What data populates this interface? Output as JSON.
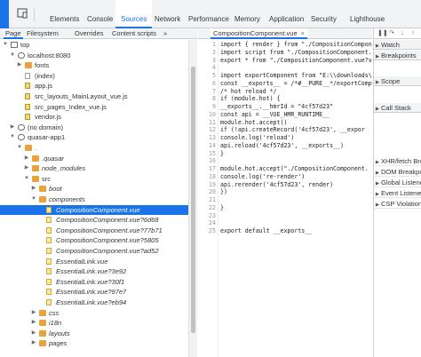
{
  "tabs": [
    "Elements",
    "Console",
    "Sources",
    "Network",
    "Performance",
    "Memory",
    "Application",
    "Security",
    "Lighthouse"
  ],
  "active_tab": "Sources",
  "navigator_tabs": [
    "Page",
    "Filesystem",
    "Overrides",
    "Content scripts"
  ],
  "navigator_more": "»",
  "tree": [
    {
      "label": "top",
      "arrow": "▼",
      "icon": "frame"
    },
    {
      "label": "localhost:8080",
      "arrow": "▼",
      "icon": "cloud"
    },
    {
      "label": "fonts",
      "arrow": "▶",
      "icon": "folder"
    },
    {
      "label": "(index)",
      "arrow": "",
      "icon": "file"
    },
    {
      "label": "app.js",
      "arrow": "",
      "icon": "file-js"
    },
    {
      "label": "src_layouts_MainLayout_vue.js",
      "arrow": "",
      "icon": "file-js"
    },
    {
      "label": "src_pages_Index_vue.js",
      "arrow": "",
      "icon": "file-js"
    },
    {
      "label": "vendor.js",
      "arrow": "",
      "icon": "file-js"
    },
    {
      "label": "(no domain)",
      "arrow": "▶",
      "icon": "cloud"
    },
    {
      "label": "quasar-app1",
      "arrow": "▼",
      "icon": "cloud"
    },
    {
      "label": ".",
      "arrow": "▼",
      "icon": "folder"
    },
    {
      "label": ".quasar",
      "arrow": "▶",
      "icon": "folder"
    },
    {
      "label": "node_modules",
      "arrow": "▶",
      "icon": "folder"
    },
    {
      "label": "src",
      "arrow": "▼",
      "icon": "folder"
    },
    {
      "label": "boot",
      "arrow": "▶",
      "icon": "folder"
    },
    {
      "label": "components",
      "arrow": "▼",
      "icon": "folder"
    },
    {
      "label": "CompositionComponent.vue",
      "arrow": "",
      "icon": "file-vue",
      "selected": true
    },
    {
      "label": "CompositionComponent.vue?6d68",
      "arrow": "",
      "icon": "file-vue"
    },
    {
      "label": "CompositionComponent.vue?77b71",
      "arrow": "",
      "icon": "file-vue"
    },
    {
      "label": "CompositionComponent.vue?5805",
      "arrow": "",
      "icon": "file-vue"
    },
    {
      "label": "CompositionComponent.vue?ad52",
      "arrow": "",
      "icon": "file-vue"
    },
    {
      "label": "EssentialLink.vue",
      "arrow": "",
      "icon": "file-vue"
    },
    {
      "label": "EssentialLink.vue?3e92",
      "arrow": "",
      "icon": "file-vue"
    },
    {
      "label": "EssentialLink.vue?30f1",
      "arrow": "",
      "icon": "file-vue"
    },
    {
      "label": "EssentialLink.vue?97e7",
      "arrow": "",
      "icon": "file-vue"
    },
    {
      "label": "EssentialLink.vue?eb94",
      "arrow": "",
      "icon": "file-vue"
    },
    {
      "label": "css",
      "arrow": "▶",
      "icon": "folder"
    },
    {
      "label": "i18n",
      "arrow": "▶",
      "icon": "folder"
    },
    {
      "label": "layouts",
      "arrow": "▶",
      "icon": "folder"
    },
    {
      "label": "pages",
      "arrow": "▶",
      "icon": "folder"
    }
  ],
  "editor": {
    "tab_label": "CompositionComponent.vue",
    "close": "×",
    "lines": [
      {
        "n": "1",
        "t": "import { render } from \"./CompositionCompon"
      },
      {
        "n": "2",
        "t": "import script from \"./CompositionComponent.v"
      },
      {
        "n": "3",
        "t": "export * from \"./CompositionComponent.vue?v"
      },
      {
        "n": "4",
        "t": ""
      },
      {
        "n": "5",
        "t": "import exportComponent from \"E:\\\\downloads\\\\"
      },
      {
        "n": "6",
        "t": "const __exports__ = /*#__PURE__*/exportComp"
      },
      {
        "n": "7",
        "t": "/* hot reload */"
      },
      {
        "n": "8",
        "t": "if (module.hot) {"
      },
      {
        "n": "9",
        "t": "  __exports__.__hmrId = \"4cf57d23\""
      },
      {
        "n": "10",
        "t": "  const api = __VUE_HMR_RUNTIME__"
      },
      {
        "n": "11",
        "t": "  module.hot.accept()"
      },
      {
        "n": "12",
        "t": "  if (!api.createRecord('4cf57d23', __expor"
      },
      {
        "n": "13",
        "t": "    console.log('reload')"
      },
      {
        "n": "14",
        "t": "    api.reload('4cf57d23', __exports__)"
      },
      {
        "n": "15",
        "t": "  }"
      },
      {
        "n": "16",
        "t": ""
      },
      {
        "n": "17",
        "t": "  module.hot.accept(\"./CompositionComponent."
      },
      {
        "n": "18",
        "t": "    console.log('re-render')"
      },
      {
        "n": "19",
        "t": "    api.rerender('4cf57d23', render)"
      },
      {
        "n": "20",
        "t": "  })"
      },
      {
        "n": "21",
        "t": ""
      },
      {
        "n": "22",
        "t": "}"
      },
      {
        "n": "23",
        "t": ""
      },
      {
        "n": "24",
        "t": ""
      },
      {
        "n": "25",
        "t": "export default __exports__"
      }
    ]
  },
  "sidebar": {
    "panes": [
      {
        "label": "Watch",
        "arrow": "▶"
      },
      {
        "label": "Breakpoints",
        "arrow": "▶"
      }
    ],
    "panes2": [
      {
        "label": "Scope",
        "arrow": "▶"
      },
      {
        "label": "Call Stack",
        "arrow": "▶"
      }
    ],
    "bp_rows": [
      {
        "label": "XHR/fetch Brea",
        "arrow": "▶"
      },
      {
        "label": "DOM Breakpoi",
        "arrow": "▶"
      },
      {
        "label": "Global Listene",
        "arrow": "▶"
      },
      {
        "label": "Event Listener",
        "arrow": "▶"
      },
      {
        "label": "CSP Violation",
        "arrow": "▶"
      }
    ]
  },
  "colors": {
    "accent": "#1a73e8",
    "folder": "#e8a33d"
  }
}
